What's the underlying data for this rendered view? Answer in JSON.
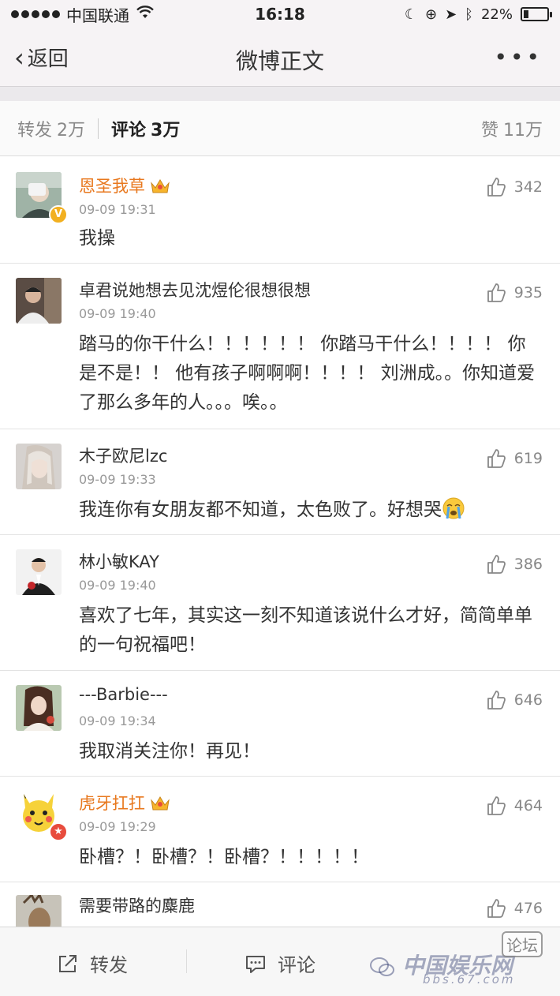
{
  "status_bar": {
    "carrier": "中国联通",
    "time": "16:18",
    "battery": "22%",
    "battery_level": 0.22
  },
  "nav": {
    "back_label": "返回",
    "title": "微博正文",
    "more_label": "•••"
  },
  "tabs": {
    "repost": {
      "label": "转发",
      "count": "2万"
    },
    "comment": {
      "label": "评论",
      "count": "3万"
    },
    "like": {
      "label": "赞",
      "count": "11万"
    }
  },
  "comments": [
    {
      "username": "恩圣我草",
      "vip": true,
      "badge": "v",
      "time": "09-09 19:31",
      "text": "我操",
      "likes": "342"
    },
    {
      "username": "卓君说她想去见沈煜伦很想很想",
      "vip": false,
      "badge": "",
      "time": "09-09 19:40",
      "text": "踏马的你干什么！！！！！！ 你踏马干什么！！！！ 你是不是！！ 他有孩子啊啊啊！！！！ 刘洲成。。你知道爱了那么多年的人。。。唉。。",
      "likes": "935"
    },
    {
      "username": "木子欧尼lzc",
      "vip": false,
      "badge": "",
      "time": "09-09 19:33",
      "text": "我连你有女朋友都不知道，太色败了。好想哭",
      "emoji": "crying-emoji",
      "likes": "619"
    },
    {
      "username": "林小敏KAY",
      "vip": false,
      "badge": "",
      "time": "09-09 19:40",
      "text": "喜欢了七年，其实这一刻不知道该说什么才好，简简单单的一句祝福吧！",
      "likes": "386"
    },
    {
      "username": "---Barbie---",
      "vip": false,
      "badge": "",
      "time": "09-09 19:34",
      "text": "我取消关注你！再见！",
      "likes": "646"
    },
    {
      "username": "虎牙扛扛",
      "vip": true,
      "badge": "star",
      "time": "09-09 19:29",
      "text": "卧槽？！卧槽？！卧槽？！！！！！",
      "likes": "464"
    },
    {
      "username": "需要带路的麋鹿",
      "vip": false,
      "badge": "",
      "time": "",
      "text": "",
      "likes": "476"
    }
  ],
  "bottom_bar": {
    "repost_label": "转发",
    "comment_label": "评论"
  },
  "watermark": {
    "main": "中国娱乐网",
    "tag": "论坛",
    "url": "bbs.67.com"
  },
  "colors": {
    "vip_name": "#e8781e",
    "background": "#ebe9ec",
    "badge_v": "#f2b020",
    "badge_star": "#e84c3d"
  }
}
